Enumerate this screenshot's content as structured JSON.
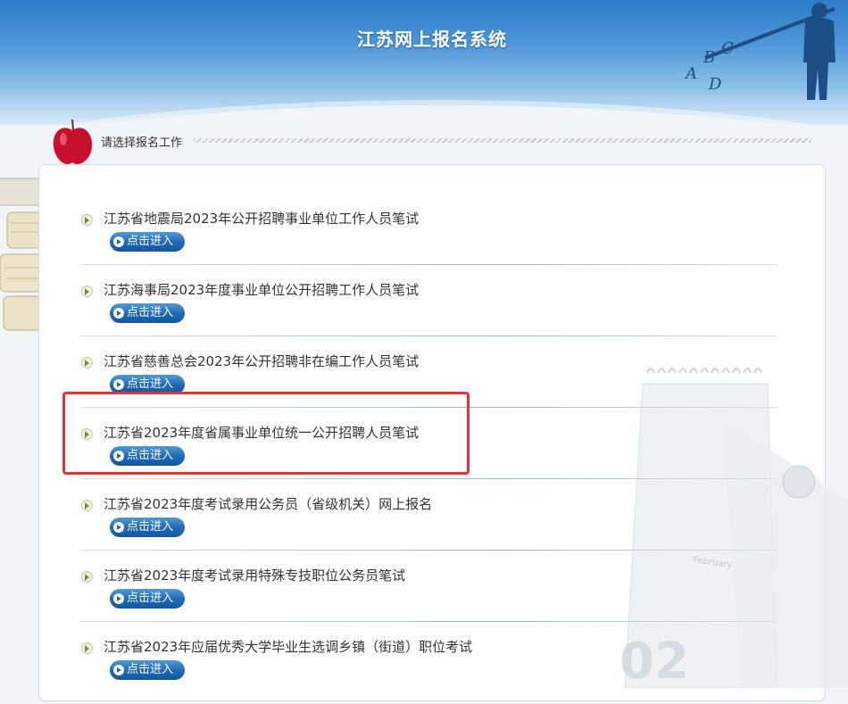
{
  "header": {
    "title": "江苏网上报名系统",
    "art_letters": [
      "A",
      "B",
      "C",
      "D"
    ]
  },
  "section": {
    "title": "请选择报名工作"
  },
  "exams": [
    {
      "name": "江苏省地震局2023年公开招聘事业单位工作人员笔试",
      "button": "点击进入"
    },
    {
      "name": "江苏海事局2023年度事业单位公开招聘工作人员笔试",
      "button": "点击进入"
    },
    {
      "name": "江苏省慈善总会2023年公开招聘非在编工作人员笔试",
      "button": "点击进入"
    },
    {
      "name": "江苏省2023年度省属事业单位统一公开招聘人员笔试",
      "button": "点击进入",
      "highlighted": true
    },
    {
      "name": "江苏省2023年度考试录用公务员（省级机关）网上报名",
      "button": "点击进入"
    },
    {
      "name": "江苏省2023年度考试录用特殊专技职位公务员笔试",
      "button": "点击进入"
    },
    {
      "name": "江苏省2023年应届优秀大学毕业生选调乡镇（街道）职位考试",
      "button": "点击进入"
    }
  ],
  "decor": {
    "calendar_month": "February",
    "calendar_day": "02"
  },
  "colors": {
    "header_blue": "#3b86cf",
    "button_blue": "#1f68b3",
    "highlight_red": "#e53333"
  }
}
